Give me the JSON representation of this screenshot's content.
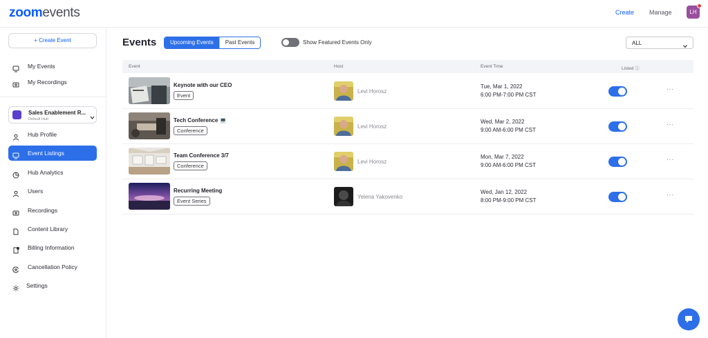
{
  "brand": {
    "logo_main": "zoom",
    "logo_sub": "events"
  },
  "topnav": {
    "create": "Create",
    "manage": "Manage",
    "avatar_initials": "LH"
  },
  "sidebar": {
    "create_event": "+ Create Event",
    "my_events": "My Events",
    "my_recordings": "My Recordings",
    "hub": {
      "name": "Sales Enablement R...",
      "sub": "Default Hub"
    },
    "items": [
      {
        "label": "Hub Profile",
        "icon": "person-icon"
      },
      {
        "label": "Event Listings",
        "icon": "monitor-icon"
      },
      {
        "label": "Hub Analytics",
        "icon": "pie-chart-icon"
      },
      {
        "label": "Users",
        "icon": "user-icon"
      },
      {
        "label": "Recordings",
        "icon": "recording-icon"
      },
      {
        "label": "Content Library",
        "icon": "document-icon"
      },
      {
        "label": "Billing Information",
        "icon": "billing-icon"
      },
      {
        "label": "Cancellation Policy",
        "icon": "cancel-policy-icon"
      },
      {
        "label": "Settings",
        "icon": "gear-icon"
      }
    ],
    "active": "Event Listings"
  },
  "main": {
    "title": "Events",
    "tabs": {
      "upcoming": "Upcoming Events",
      "past": "Past Events"
    },
    "featured_toggle_label": "Show Featured Events Only",
    "featured_toggle_on": false,
    "filter_value": "ALL"
  },
  "table": {
    "headers": {
      "event": "Event",
      "host": "Host",
      "time": "Event Time",
      "listed": "Listed"
    },
    "rows": [
      {
        "name": "Keynote with our CEO",
        "type": "Event",
        "host": "Levi Horosz",
        "date": "Tue, Mar 1, 2022",
        "time": "6:00 PM-7:00 PM CST",
        "listed": true
      },
      {
        "name": "Tech Conference 💻",
        "type": "Conference",
        "host": "Levi Horosz",
        "date": "Wed, Mar 2, 2022",
        "time": "9:00 AM-6:00 PM CST",
        "listed": true
      },
      {
        "name": "Team Conference 3/7",
        "type": "Conference",
        "host": "Levi Horosz",
        "date": "Mon, Mar 7, 2022",
        "time": "9:00 AM-6:00 PM CST",
        "listed": true
      },
      {
        "name": "Recurring Meeting",
        "type": "Event Series",
        "host": "Yelena Yakovenko",
        "date": "Wed, Jan 12, 2022",
        "time": "8:00 PM-9:00 PM CST",
        "listed": true
      }
    ],
    "more_label": "···"
  },
  "colors": {
    "accent": "#2d6fe8",
    "brand": "#0b5cff"
  }
}
